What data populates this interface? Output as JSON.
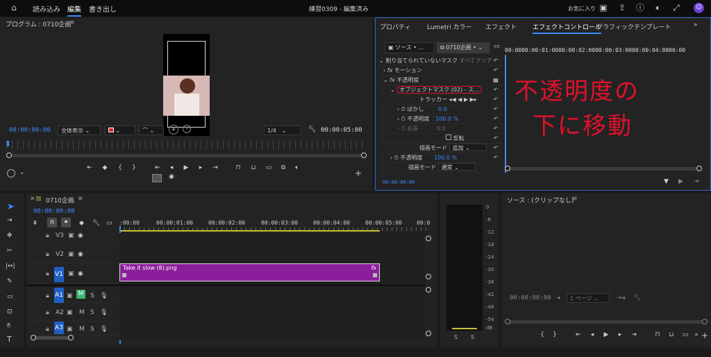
{
  "topbar": {
    "nav": [
      "読み込み",
      "編集",
      "書き出し"
    ],
    "title": "練習0309 - 編集済み",
    "favorites": "お気に入り"
  },
  "program": {
    "title": "プログラム : 0710企画",
    "timecode_in": "00:00:00:00",
    "fit": "全体表示",
    "resolution": "1/4",
    "timecode_out": "00:00:05:00"
  },
  "effect_panel": {
    "tabs": [
      "プロパティ",
      "Lumetri カラー",
      "エフェクト",
      "エフェクトコントロール",
      "グラフィックテンプレート"
    ],
    "active_tab": "エフェクトコントロール",
    "source": "ソース •",
    "clip": "0710企画 •",
    "ruler": [
      "00:00",
      "00:00:01:00",
      "00:00:02:00",
      "00:00:03:00",
      "00:00:04:00",
      "00:00"
    ],
    "rows": [
      {
        "label": "割り当てられていないマスク",
        "value": "すべてクリア"
      },
      {
        "label": "モーション"
      },
      {
        "label": "不透明度"
      },
      {
        "label": "オブジェクトマスク (02) - ス..."
      },
      {
        "label": "トラッカー"
      },
      {
        "label": "ぼかし",
        "value": "0.0"
      },
      {
        "label": "不透明度",
        "value": "100.0 %"
      },
      {
        "label": "拡張",
        "value": "0.0"
      },
      {
        "label": "反転"
      },
      {
        "label": "描画モード",
        "value": "追加"
      },
      {
        "label": "不透明度",
        "value": "100.0 %"
      },
      {
        "label": "描画モード",
        "value": "通常"
      }
    ],
    "timecode": "00:00:00:00",
    "annotation_line1": "不透明度の",
    "annotation_line2": "下に移動"
  },
  "timeline": {
    "title": "0710企画",
    "timecode": "00:00:00:00",
    "ruler": [
      ":00:00",
      "00:00:01:00",
      "00:00:02:00",
      "00:00:03:00",
      "00:00:04:00",
      "00:00:05:00",
      "00:0"
    ],
    "tracks": [
      {
        "name": "V3"
      },
      {
        "name": "V2"
      },
      {
        "name": "V1"
      },
      {
        "name": "A1",
        "m": "M",
        "s": "S"
      },
      {
        "name": "A2",
        "m": "M",
        "s": "S"
      },
      {
        "name": "A3",
        "m": "M",
        "s": "S"
      }
    ],
    "clip_name": "Take it slow (8).png",
    "clip_fx": "fx",
    "clip_color": "#8c1f9c"
  },
  "meter": {
    "ticks": [
      "0",
      "-6",
      "-12",
      "-18",
      "-24",
      "-30",
      "-36",
      "-42",
      "-48",
      "-54",
      "dB"
    ],
    "footer": [
      "S",
      "S"
    ]
  },
  "source_panel": {
    "title": "ソース : (クリップなし)",
    "timecode": "00:00:00:00",
    "page": "1 ページ"
  },
  "colors": {
    "accent": "#3d8bff",
    "annotation": "#e0112b",
    "clip": "#8c1f9c"
  }
}
